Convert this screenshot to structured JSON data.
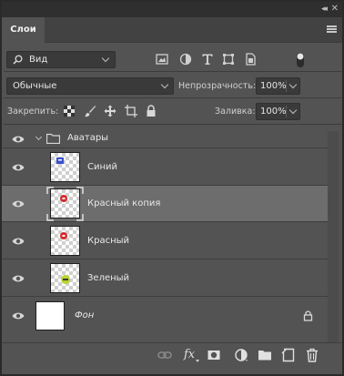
{
  "panel": {
    "tab_label": "Слои",
    "collapse_glyph": "◂◂",
    "close_glyph": "✕"
  },
  "filter": {
    "kind_label": "Вид",
    "icons": [
      "image-filter-icon",
      "adjustment-filter-icon",
      "type-filter-icon",
      "shape-filter-icon",
      "smart-object-filter-icon"
    ],
    "toggle": "filter-toggle"
  },
  "blend": {
    "mode": "Обычные",
    "opacity_label": "Непрозрачность:",
    "opacity_value": "100%"
  },
  "lock": {
    "label": "Закрепить:",
    "fill_label": "Заливка:",
    "fill_value": "100%"
  },
  "layers": [
    {
      "type": "group",
      "name": "Аватары",
      "visible": true,
      "expanded": true
    },
    {
      "type": "layer",
      "name": "Синий",
      "visible": true,
      "selected": false,
      "thumb_color": "#3a4fcf"
    },
    {
      "type": "layer",
      "name": "Красный копия",
      "visible": true,
      "selected": true,
      "thumb_color": "#d42a2a"
    },
    {
      "type": "layer",
      "name": "Красный",
      "visible": true,
      "selected": false,
      "thumb_color": "#d42a2a"
    },
    {
      "type": "layer",
      "name": "Зеленый",
      "visible": true,
      "selected": false,
      "thumb_color": "#b8d430"
    },
    {
      "type": "background",
      "name": "Фон",
      "visible": true,
      "selected": false,
      "locked": true
    }
  ],
  "bottom_toolbar": {
    "fx_label": "fx",
    "icons": [
      "link-layers-icon",
      "fx-icon",
      "add-mask-icon",
      "new-adjustment-layer-icon",
      "new-group-icon",
      "new-layer-icon",
      "delete-layer-icon"
    ]
  },
  "colors": {
    "panel_bg": "#535353",
    "selected_row": "#6d6d6d",
    "field_bg": "#3a3a3a"
  }
}
